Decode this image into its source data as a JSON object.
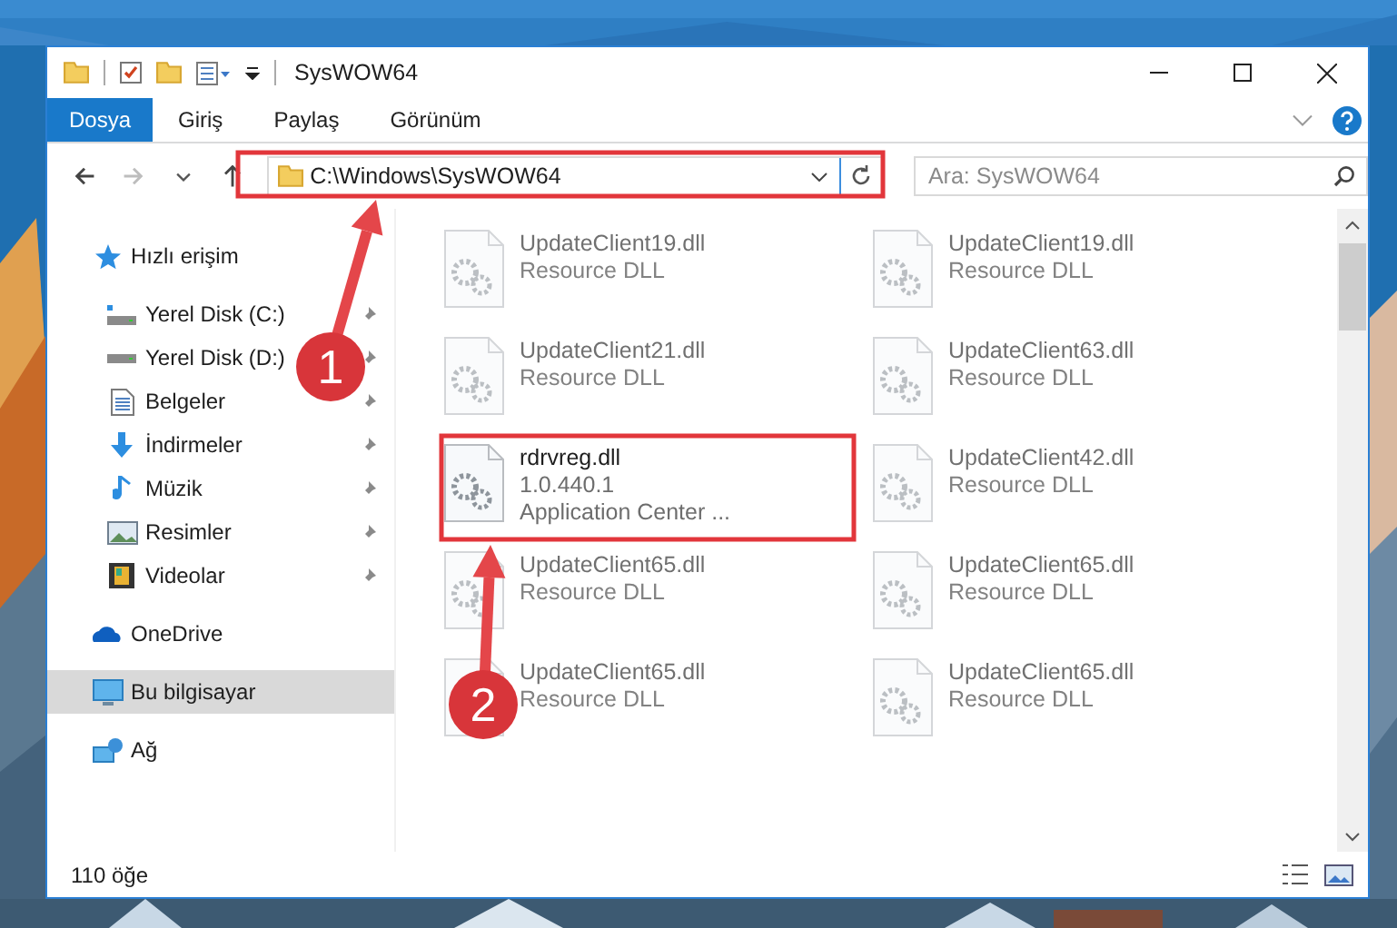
{
  "window": {
    "title": "SysWOW64"
  },
  "ribbon_tabs": [
    {
      "label": "Dosya",
      "selected": true
    },
    {
      "label": "Giriş",
      "selected": false
    },
    {
      "label": "Paylaş",
      "selected": false
    },
    {
      "label": "Görünüm",
      "selected": false
    }
  ],
  "history_buttons": [
    {
      "kind": "back",
      "disabled": false
    },
    {
      "kind": "forward",
      "disabled": true
    }
  ],
  "address_bar": {
    "value": "C:\\Windows\\SysWOW64"
  },
  "search": {
    "placeholder": "Ara: SysWOW64"
  },
  "sidebar": {
    "items": [
      {
        "label": "Hızlı erişim",
        "selected": false,
        "children": [
          {
            "label": "Yerel Disk (C:)",
            "pinned": true
          },
          {
            "label": "Yerel Disk (D:)",
            "pinned": true
          },
          {
            "label": "Belgeler",
            "pinned": true
          },
          {
            "label": "İndirmeler",
            "pinned": true
          },
          {
            "label": "Müzik",
            "pinned": true
          },
          {
            "label": "Resimler",
            "pinned": true
          },
          {
            "label": "Videolar",
            "pinned": true
          }
        ]
      },
      {
        "label": "OneDrive",
        "selected": false
      },
      {
        "label": "Bu bilgisayar",
        "selected": true
      },
      {
        "label": "Ağ",
        "selected": false
      }
    ]
  },
  "files": [
    {
      "name": "UpdateClient19.dll",
      "details": [
        "Resource DLL"
      ],
      "blurred": true
    },
    {
      "name": "UpdateClient19.dll",
      "details": [
        "Resource DLL"
      ],
      "blurred": true
    },
    {
      "name": "UpdateClient21.dll",
      "details": [
        "Resource DLL"
      ],
      "blurred": true
    },
    {
      "name": "UpdateClient63.dll",
      "details": [
        "Resource DLL"
      ],
      "blurred": true
    },
    {
      "name": "rdrvreg.dll",
      "details": [
        "1.0.440.1",
        "Application Center ..."
      ],
      "blurred": false
    },
    {
      "name": "UpdateClient42.dll",
      "details": [
        "Resource DLL"
      ],
      "blurred": true
    },
    {
      "name": "UpdateClient65.dll",
      "details": [
        "Resource DLL"
      ],
      "blurred": true
    },
    {
      "name": "UpdateClient65.dll",
      "details": [
        "Resource DLL"
      ],
      "blurred": true
    },
    {
      "name": "UpdateClient65.dll",
      "details": [
        "Resource DLL"
      ],
      "blurred": true
    },
    {
      "name": "UpdateClient65.dll",
      "details": [
        "Resource DLL"
      ],
      "blurred": true
    }
  ],
  "status_bar": {
    "item_count": "110 öğe"
  },
  "annotations": [
    {
      "label": "1"
    },
    {
      "label": "2"
    }
  ]
}
